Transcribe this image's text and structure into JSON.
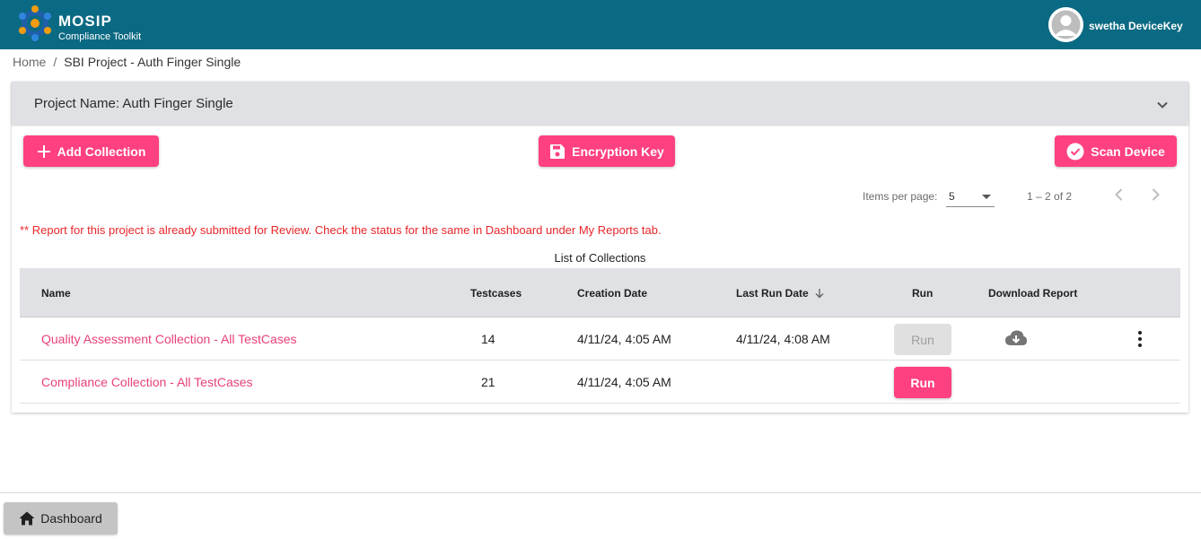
{
  "app": {
    "brand_name": "MOSIP",
    "brand_sub": "Compliance Toolkit",
    "user_name": "swetha DeviceKey",
    "header_color": "#0b6a83",
    "accent_color": "#ff4081"
  },
  "breadcrumb": {
    "home": "Home",
    "separator": "/",
    "current": "SBI Project - Auth Finger Single"
  },
  "project": {
    "title": "Project Name: Auth Finger Single"
  },
  "actions": {
    "add_collection": "Add Collection",
    "encryption_key": "Encryption Key",
    "scan_device": "Scan Device"
  },
  "pagination": {
    "items_per_page_label": "Items per page:",
    "items_per_page_value": "5",
    "range": "1 – 2 of 2"
  },
  "report_message": "** Report for this project is already submitted for Review. Check the status for the same in Dashboard under My Reports tab.",
  "table": {
    "title": "List of Collections",
    "headers": {
      "name": "Name",
      "testcases": "Testcases",
      "creation_date": "Creation Date",
      "last_run_date": "Last Run Date",
      "run": "Run",
      "download_report": "Download Report"
    },
    "rows": [
      {
        "name": "Quality Assessment Collection - All TestCases",
        "testcases": "14",
        "creation_date": "4/11/24, 4:05 AM",
        "last_run_date": "4/11/24, 4:08 AM",
        "run_label": "Run"
      },
      {
        "name": "Compliance Collection - All TestCases",
        "testcases": "21",
        "creation_date": "4/11/24, 4:05 AM",
        "last_run_date": "",
        "run_label": "Run"
      }
    ]
  },
  "footer": {
    "dashboard_label": "Dashboard"
  }
}
